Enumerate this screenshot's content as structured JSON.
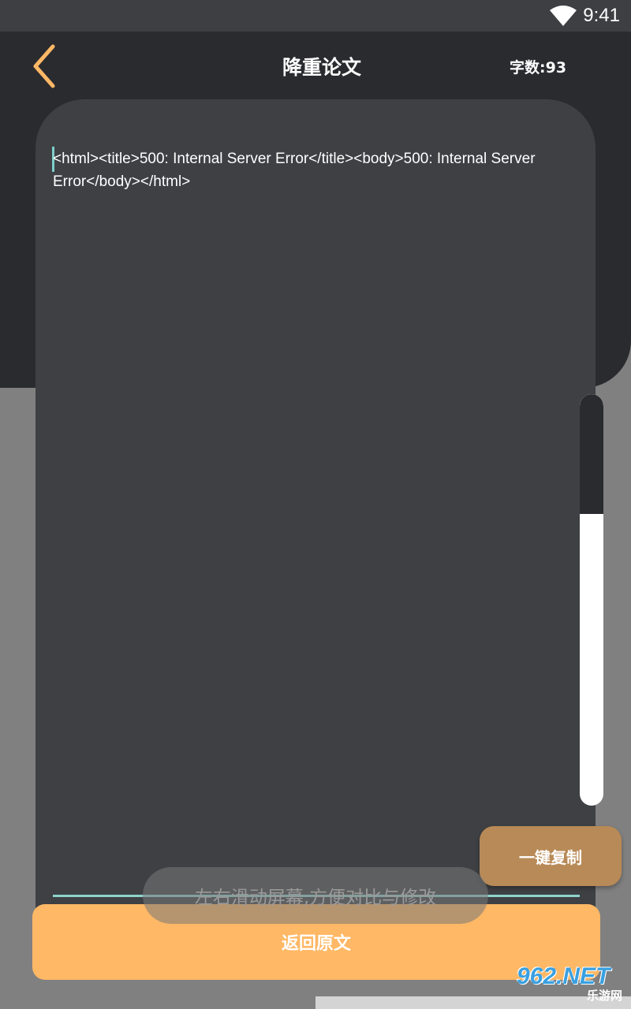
{
  "status_bar": {
    "time": "9:41"
  },
  "header": {
    "back_icon": "chevron-left-icon",
    "title": "降重论文",
    "word_count": "字数:93"
  },
  "editor": {
    "content": "<html><title>500: Internal Server Error</title><body>500: Internal Server Error</body></html>"
  },
  "scrollbar": {
    "position_fraction": 0.0
  },
  "actions": {
    "copy_label": "一键复制",
    "return_label": "返回原文"
  },
  "toast": {
    "message": "左右滑动屏幕,方便对比与修改"
  },
  "watermark": {
    "main": "962.NET",
    "sub": "乐游网"
  },
  "colors": {
    "accent": "#ffb865",
    "copy_button": "#b88a57",
    "caret": "#7ecfca",
    "header_bg": "#2a2b2f",
    "card_bg": "#3e4044"
  }
}
